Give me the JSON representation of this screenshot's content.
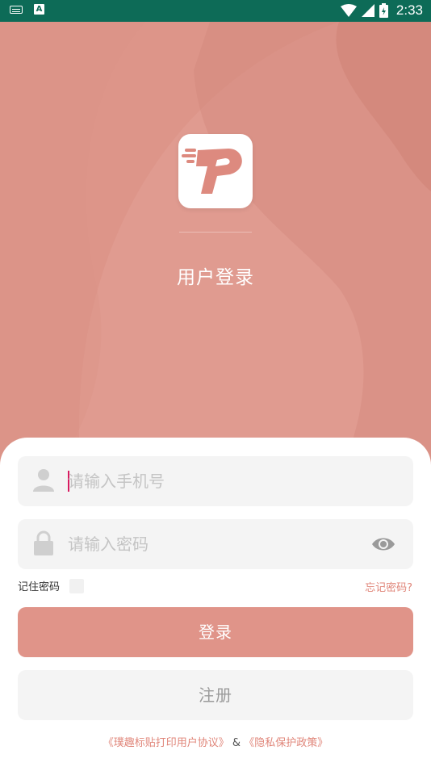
{
  "status_bar": {
    "time": "2:33",
    "icons": [
      "keyboard-icon",
      "a-notification-icon",
      "wifi-icon",
      "signal-icon",
      "battery-icon"
    ]
  },
  "header": {
    "title": "用户登录",
    "logo_icon": "app-logo-p"
  },
  "form": {
    "phone": {
      "placeholder": "请输入手机号",
      "value": "",
      "icon": "user-icon"
    },
    "password": {
      "placeholder": "请输入密码",
      "value": "",
      "icon": "lock-icon",
      "toggle_icon": "eye-icon"
    },
    "remember_label": "记住密码",
    "remember_checked": false,
    "forgot_label": "忘记密码?"
  },
  "buttons": {
    "login": "登录",
    "register": "注册"
  },
  "agreement": {
    "user_agreement": "《璞趣标贴打印用户协议》",
    "separator": "&",
    "privacy_policy": "《隐私保护政策》"
  },
  "colors": {
    "status_bar": "#0d6b57",
    "hero": "#dd9589",
    "accent": "#e09489",
    "link": "#e0867a"
  }
}
